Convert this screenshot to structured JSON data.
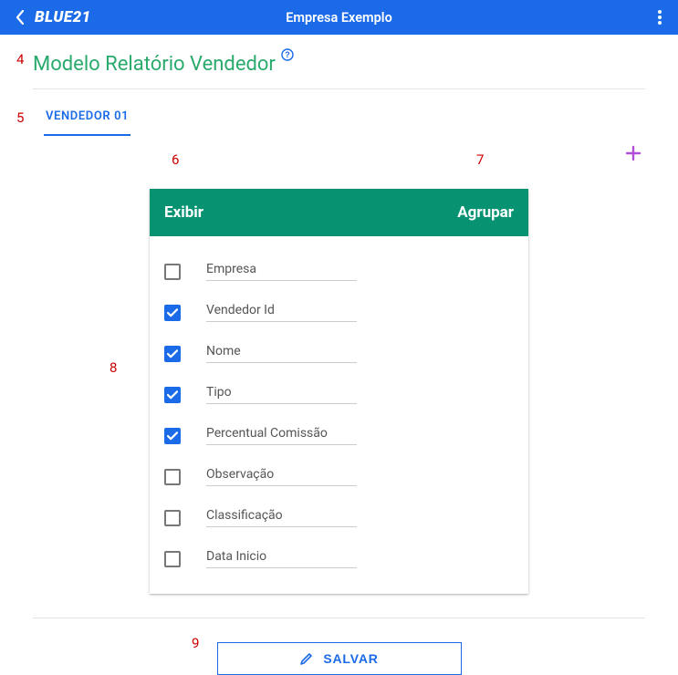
{
  "appbar": {
    "logo": "BLUE21",
    "title": "Empresa Exemplo"
  },
  "page": {
    "title": "Modelo Relatório Vendedor"
  },
  "tabs": [
    {
      "label": "VENDEDOR 01"
    }
  ],
  "card": {
    "col_show": "Exibir",
    "col_group": "Agrupar"
  },
  "fields": [
    {
      "label": "Empresa",
      "checked": false
    },
    {
      "label": "Vendedor Id",
      "checked": true
    },
    {
      "label": "Nome",
      "checked": true
    },
    {
      "label": "Tipo",
      "checked": true
    },
    {
      "label": "Percentual Comissão",
      "checked": true
    },
    {
      "label": "Observação",
      "checked": false
    },
    {
      "label": "Classificação",
      "checked": false
    },
    {
      "label": "Data Inicio",
      "checked": false
    }
  ],
  "actions": {
    "save": "SALVAR"
  },
  "annotations": {
    "a4": "4",
    "a5": "5",
    "a6": "6",
    "a7": "7",
    "a8": "8",
    "a9": "9"
  }
}
